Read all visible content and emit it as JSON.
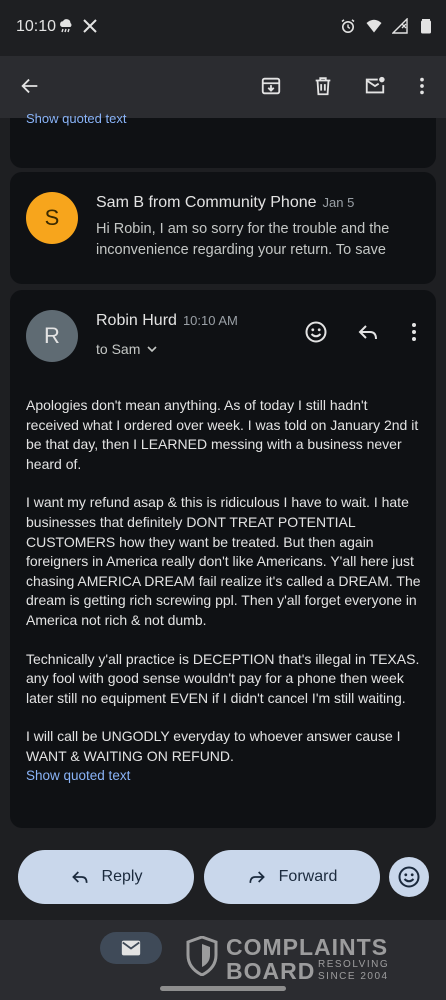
{
  "status_bar": {
    "time": "10:10",
    "left_icons": [
      "cloud-rain-icon",
      "x-logo-icon"
    ],
    "right_icons": [
      "alarm-icon",
      "wifi-icon",
      "signal-icon",
      "battery-icon"
    ]
  },
  "toolbar": {
    "icons": [
      "back-arrow-icon",
      "archive-icon",
      "delete-icon",
      "mark-unread-icon",
      "more-vert-icon"
    ]
  },
  "thread": {
    "quoted_top_label": "Show quoted text",
    "collapsed_message": {
      "avatar_letter": "S",
      "avatar_color": "#f7a51c",
      "sender": "Sam B from Community Phone",
      "date": "Jan 5",
      "snippet": "Hi Robin, I am so sorry for the trouble and the inconvenience regarding your return. To save"
    },
    "open_message": {
      "avatar_letter": "R",
      "avatar_color": "#5f6b73",
      "sender": "Robin Hurd",
      "time": "10:10 AM",
      "recipient": "to Sam",
      "paragraphs": [
        "Apologies don't mean anything. As of today I still hadn't received what I ordered over week. I was told on January 2nd it be that day, then I LEARNED messing with a business never heard of.",
        "I want my refund asap & this is ridiculous I have to wait. I hate businesses that definitely DONT TREAT POTENTIAL CUSTOMERS how they want be treated. But then again foreigners in America really don't like Americans. Y'all here just chasing AMERICA DREAM fail realize it's called a DREAM. The dream is getting rich screwing ppl. Then y'all forget everyone in America not rich & not dumb.",
        "Technically y'all practice is DECEPTION that's illegal in TEXAS. any fool with good sense wouldn't pay for a phone then week later still no equipment EVEN if I didn't cancel I'm still waiting.",
        "I will call be UNGODLY everyday to whoever answer cause I WANT & WAITING ON REFUND."
      ],
      "quoted_label": "Show quoted text"
    }
  },
  "actions": {
    "reply_label": "Reply",
    "forward_label": "Forward"
  },
  "colors": {
    "background": "#1e1f22",
    "card": "#0f1114",
    "link": "#8ab4f8",
    "pill": "#c9d7eb"
  },
  "watermark": {
    "line1": "COMPLAINTS",
    "line2": "BOARD",
    "tagline1": "RESOLVING",
    "tagline2": "SINCE 2004"
  }
}
